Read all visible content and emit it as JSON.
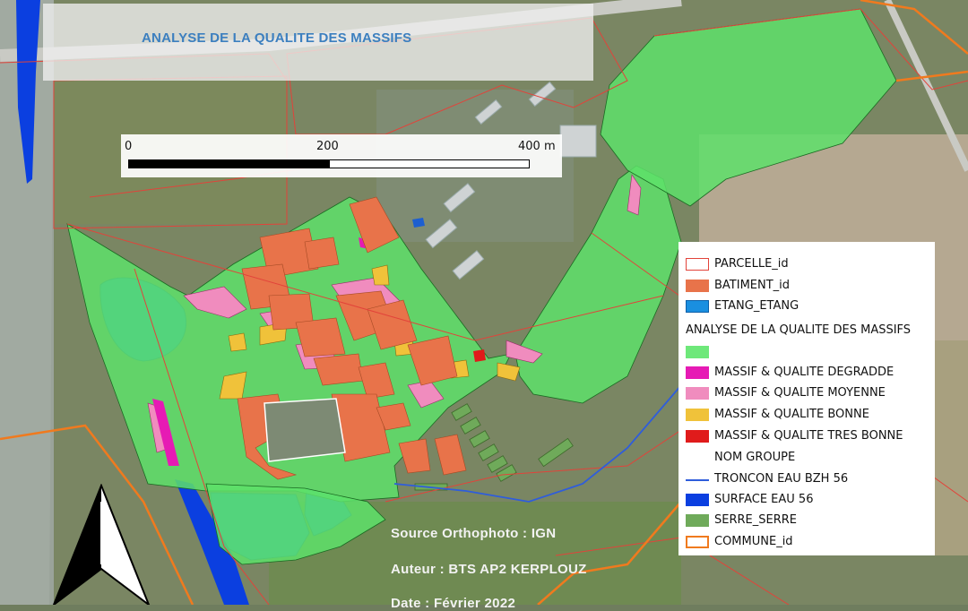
{
  "map": {
    "title": "ANALYSE DE LA QUALITE DES MASSIFS",
    "scale_bar": {
      "labels": [
        "0",
        "200",
        "400 m"
      ]
    },
    "legend": {
      "items": [
        {
          "label": "PARCELLE_id",
          "symbol": "outline",
          "color": "#e2433a"
        },
        {
          "label": "BATIMENT_id",
          "symbol": "fill",
          "color": "#e8734a"
        },
        {
          "label": "ETANG_ETANG",
          "symbol": "fill",
          "color": "#1a8fe0"
        }
      ],
      "group_title": "ANALYSE DE LA QUALITE DES MASSIFS",
      "classes": [
        {
          "label": "",
          "color": "#6ee87a"
        },
        {
          "label": "MASSIF & QUALITE DEGRADDE",
          "color": "#e61ab4"
        },
        {
          "label": "MASSIF & QUALITE MOYENNE",
          "color": "#f08cbe"
        },
        {
          "label": "MASSIF & QUALITE BONNE",
          "color": "#f0c23a"
        },
        {
          "label": "MASSIF & QUALITE TRES BONNE",
          "color": "#e01b1b"
        }
      ],
      "group_label": "NOM GROUPE",
      "layers": [
        {
          "label": "TRONCON EAU BZH 56",
          "symbol": "line",
          "color": "#2f5ddb"
        },
        {
          "label": "SURFACE EAU 56",
          "symbol": "fill",
          "color": "#0b3fe0"
        },
        {
          "label": "SERRE_SERRE",
          "symbol": "fill",
          "color": "#6faa5a"
        },
        {
          "label": "COMMUNE_id",
          "symbol": "outline-thick",
          "color": "#f07a1e"
        }
      ]
    },
    "credits": {
      "source": "Source Orthophoto : IGN",
      "author": "Auteur : BTS AP2 KERPLOUZ",
      "date": "Date : Février 2022"
    },
    "colors": {
      "green_massif": "#5ee06a",
      "building": "#e8734a",
      "pond": "#1a8fe0",
      "water_surface": "#0b3fe0",
      "parcel_outline": "#e2433a",
      "commune_outline": "#f07a1e"
    },
    "icons": [
      "north-arrow-icon"
    ]
  }
}
